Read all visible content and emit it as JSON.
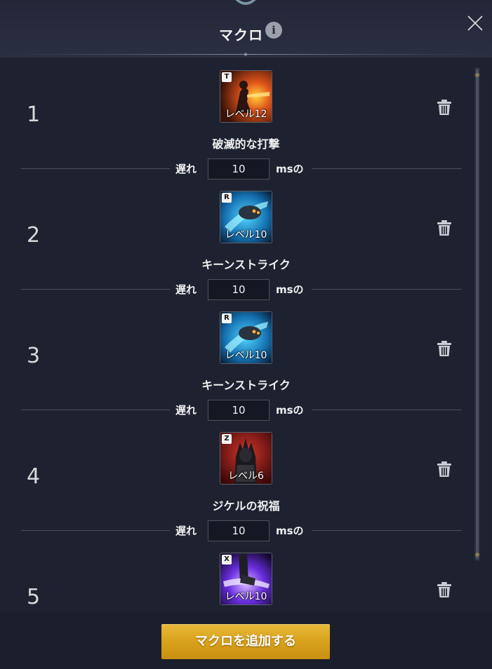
{
  "header": {
    "title": "マクロ",
    "info_icon": "info-icon",
    "close_icon": "close-icon"
  },
  "macros": [
    {
      "number": "1",
      "hotkey": "T",
      "level": "レベル12",
      "skill": "破滅的な打撃",
      "delay_label": "遅れ",
      "delay_value": "10",
      "delay_unit": "msの",
      "art": "fire"
    },
    {
      "number": "2",
      "hotkey": "R",
      "level": "レベル10",
      "skill": "キーンストライク",
      "delay_label": "遅れ",
      "delay_value": "10",
      "delay_unit": "msの",
      "art": "blue"
    },
    {
      "number": "3",
      "hotkey": "R",
      "level": "レベル10",
      "skill": "キーンストライク",
      "delay_label": "遅れ",
      "delay_value": "10",
      "delay_unit": "msの",
      "art": "blue"
    },
    {
      "number": "4",
      "hotkey": "Z",
      "level": "レベル6",
      "skill": "ジケルの祝福",
      "delay_label": "遅れ",
      "delay_value": "10",
      "delay_unit": "msの",
      "art": "red"
    },
    {
      "number": "5",
      "hotkey": "X",
      "level": "レベル10",
      "skill": "",
      "delay_label": "",
      "delay_value": "",
      "delay_unit": "",
      "art": "purple"
    }
  ],
  "footer": {
    "add_button_label": "マクロを追加する"
  },
  "colors": {
    "background": "#1e2230",
    "button_gold": "#d9a21b",
    "text": "#f0f0f0"
  }
}
